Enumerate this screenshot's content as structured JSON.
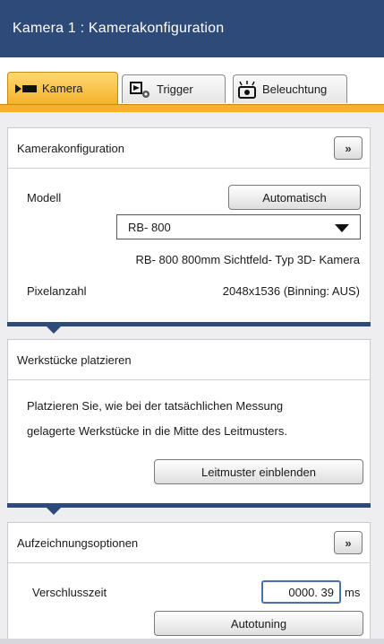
{
  "window": {
    "title": "Kamera 1 : Kamerakonfiguration"
  },
  "tabs": [
    {
      "label": "Kamera",
      "icon": "camera-icon",
      "active": true
    },
    {
      "label": "Trigger",
      "icon": "trigger-icon",
      "active": false
    },
    {
      "label": "Beleuchtung",
      "icon": "lighting-icon",
      "active": false
    }
  ],
  "camera_config": {
    "title": "Kamerakonfiguration",
    "expand_label": "»",
    "model_label": "Modell",
    "auto_button": "Automatisch",
    "model_value": "RB- 800",
    "model_info": "RB- 800   800mm  Sichtfeld- Typ  3D- Kamera",
    "pixel_label": "Pixelanzahl",
    "pixel_value": "2048x1536  (Binning: AUS)"
  },
  "workpieces": {
    "title": "Werkstücke platzieren",
    "line1": "Platzieren Sie, wie bei der tatsächlichen Messung",
    "line2": "gelagerte Werkstücke in die Mitte des Leitmusters.",
    "show_button": "Leitmuster einblenden"
  },
  "recording": {
    "title": "Aufzeichnungsoptionen",
    "expand_label": "»",
    "shutter_label": "Verschlusszeit",
    "shutter_value": "0000. 39",
    "shutter_unit": "ms",
    "autotune_button": "Autotuning"
  },
  "colors": {
    "header": "#2e4a78",
    "tab_active": "#f3b22c",
    "accent_border": "#4a70a8"
  }
}
